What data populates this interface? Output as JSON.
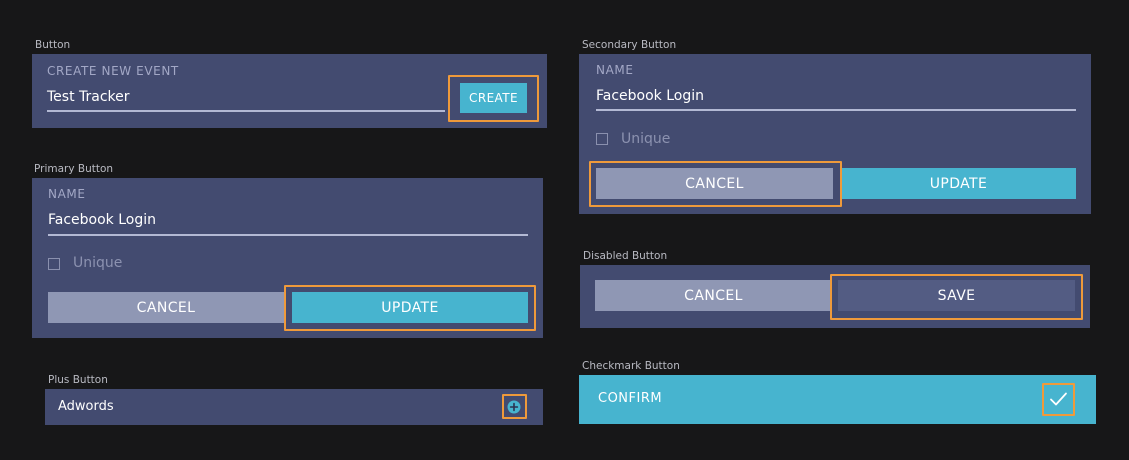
{
  "colors": {
    "background": "#171718",
    "panel": "#434b70",
    "accent": "#47b4cf",
    "cancel": "#8f97b4",
    "disabled": "#535c83",
    "highlight": "#ef9a3b"
  },
  "button_demo": {
    "caption": "Button",
    "label": "CREATE NEW EVENT",
    "value": "Test Tracker",
    "button_label": "CREATE"
  },
  "primary_demo": {
    "caption": "Primary Button",
    "label": "NAME",
    "value": "Facebook Login",
    "checkbox_label": "Unique",
    "checkbox_checked": false,
    "cancel_label": "CANCEL",
    "update_label": "UPDATE"
  },
  "plus_demo": {
    "caption": "Plus Button",
    "item_label": "Adwords",
    "icon": "plus-circle-icon"
  },
  "secondary_demo": {
    "caption": "Secondary Button",
    "label": "NAME",
    "value": "Facebook Login",
    "checkbox_label": "Unique",
    "checkbox_checked": false,
    "cancel_label": "CANCEL",
    "update_label": "UPDATE"
  },
  "disabled_demo": {
    "caption": "Disabled Button",
    "cancel_label": "CANCEL",
    "save_label": "SAVE"
  },
  "checkmark_demo": {
    "caption": "Checkmark Button",
    "label": "CONFIRM",
    "icon": "checkmark-icon"
  }
}
